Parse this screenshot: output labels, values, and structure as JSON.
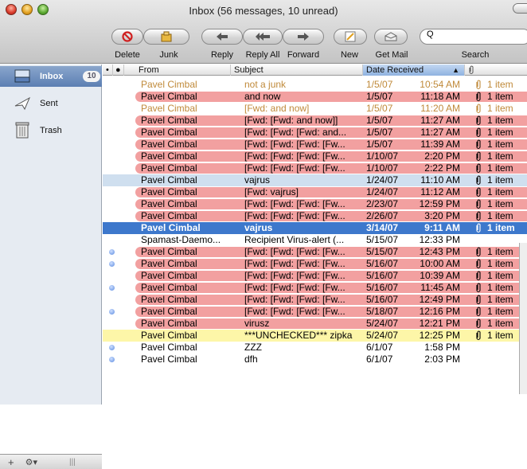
{
  "window": {
    "title": "Inbox (56 messages, 10 unread)"
  },
  "toolbar": {
    "delete_label": "Delete",
    "junk_label": "Junk",
    "reply_label": "Reply",
    "reply_all_label": "Reply All",
    "forward_label": "Forward",
    "new_label": "New",
    "get_mail_label": "Get Mail",
    "search_label": "Search",
    "search_placeholder": "Q"
  },
  "sidebar": {
    "items": [
      {
        "label": "Inbox",
        "badge": "10",
        "icon": "inbox-icon"
      },
      {
        "label": "Sent",
        "icon": "sent-icon"
      },
      {
        "label": "Trash",
        "icon": "trash-icon"
      }
    ],
    "bottom": {
      "add": "+",
      "action": "⚙▾"
    }
  },
  "columns": {
    "from": "From",
    "subject": "Subject",
    "date": "Date Received",
    "sort_arrow": "▲"
  },
  "messages": [
    {
      "from": "Pavel Cimbal",
      "subject": "not a junk",
      "date": "1/5/07",
      "time": "10:54 AM",
      "att": "1 item",
      "style": "junk"
    },
    {
      "from": "Pavel Cimbal",
      "subject": "and now",
      "date": "1/5/07",
      "time": "11:18 AM",
      "att": "1 item",
      "style": "red"
    },
    {
      "from": "Pavel Cimbal",
      "subject": "[Fwd: and now]",
      "date": "1/5/07",
      "time": "11:20 AM",
      "att": "1 item",
      "style": "junk"
    },
    {
      "from": "Pavel Cimbal",
      "subject": "[Fwd: [Fwd: and now]]",
      "date": "1/5/07",
      "time": "11:27 AM",
      "att": "1 item",
      "style": "red"
    },
    {
      "from": "Pavel Cimbal",
      "subject": "[Fwd: [Fwd: [Fwd: and...",
      "date": "1/5/07",
      "time": "11:27 AM",
      "att": "1 item",
      "style": "red"
    },
    {
      "from": "Pavel Cimbal",
      "subject": "[Fwd: [Fwd: [Fwd: [Fw...",
      "date": "1/5/07",
      "time": "11:39 AM",
      "att": "1 item",
      "style": "red"
    },
    {
      "from": "Pavel Cimbal",
      "subject": "[Fwd: [Fwd: [Fwd: [Fw...",
      "date": "1/10/07",
      "time": "2:20 PM",
      "att": "1 item",
      "style": "red"
    },
    {
      "from": "Pavel Cimbal",
      "subject": "[Fwd: [Fwd: [Fwd: [Fw...",
      "date": "1/10/07",
      "time": "2:22 PM",
      "att": "1 item",
      "style": "red"
    },
    {
      "from": "Pavel Cimbal",
      "subject": "vajrus",
      "date": "1/24/07",
      "time": "11:10 AM",
      "att": "1 item",
      "style": "blue"
    },
    {
      "from": "Pavel Cimbal",
      "subject": "[Fwd: vajrus]",
      "date": "1/24/07",
      "time": "11:12 AM",
      "att": "1 item",
      "style": "red"
    },
    {
      "from": "Pavel Cimbal",
      "subject": "[Fwd: [Fwd: [Fwd: [Fw...",
      "date": "2/23/07",
      "time": "12:59 PM",
      "att": "1 item",
      "style": "red"
    },
    {
      "from": "Pavel Cimbal",
      "subject": "[Fwd: [Fwd: [Fwd: [Fw...",
      "date": "2/26/07",
      "time": "3:20 PM",
      "att": "1 item",
      "style": "red"
    },
    {
      "from": "Pavel Cimbal",
      "subject": "vajrus",
      "date": "3/14/07",
      "time": "9:11 AM",
      "att": "1 item",
      "style": "sel"
    },
    {
      "from": "Spamast-Daemo...",
      "subject": "Recipient Virus-alert (...",
      "date": "5/15/07",
      "time": "12:33 PM",
      "att": "",
      "style": "plain"
    },
    {
      "from": "Pavel Cimbal",
      "subject": "[Fwd: [Fwd: [Fwd: [Fw...",
      "date": "5/15/07",
      "time": "12:43 PM",
      "att": "1 item",
      "style": "red",
      "unread": true
    },
    {
      "from": "Pavel Cimbal",
      "subject": "[Fwd: [Fwd: [Fwd: [Fw...",
      "date": "5/16/07",
      "time": "10:00 AM",
      "att": "1 item",
      "style": "red",
      "unread": true
    },
    {
      "from": "Pavel Cimbal",
      "subject": "[Fwd: [Fwd: [Fwd: [Fw...",
      "date": "5/16/07",
      "time": "10:39 AM",
      "att": "1 item",
      "style": "red"
    },
    {
      "from": "Pavel Cimbal",
      "subject": "[Fwd: [Fwd: [Fwd: [Fw...",
      "date": "5/16/07",
      "time": "11:45 AM",
      "att": "1 item",
      "style": "red",
      "unread": true
    },
    {
      "from": "Pavel Cimbal",
      "subject": "[Fwd: [Fwd: [Fwd: [Fw...",
      "date": "5/16/07",
      "time": "12:49 PM",
      "att": "1 item",
      "style": "red"
    },
    {
      "from": "Pavel Cimbal",
      "subject": "[Fwd: [Fwd: [Fwd: [Fw...",
      "date": "5/18/07",
      "time": "12:16 PM",
      "att": "1 item",
      "style": "red",
      "unread": true
    },
    {
      "from": "Pavel Cimbal",
      "subject": "virusz",
      "date": "5/24/07",
      "time": "12:21 PM",
      "att": "1 item",
      "style": "red"
    },
    {
      "from": "Pavel Cimbal",
      "subject": "***UNCHECKED*** zipka",
      "date": "5/24/07",
      "time": "12:25 PM",
      "att": "1 item",
      "style": "yellow"
    },
    {
      "from": "Pavel Cimbal",
      "subject": "ZZZ",
      "date": "6/1/07",
      "time": "1:58 PM",
      "att": "",
      "style": "plain",
      "unread": true
    },
    {
      "from": "Pavel Cimbal",
      "subject": "dfh",
      "date": "6/1/07",
      "time": "2:03 PM",
      "att": "",
      "style": "plain",
      "unread": true
    }
  ]
}
